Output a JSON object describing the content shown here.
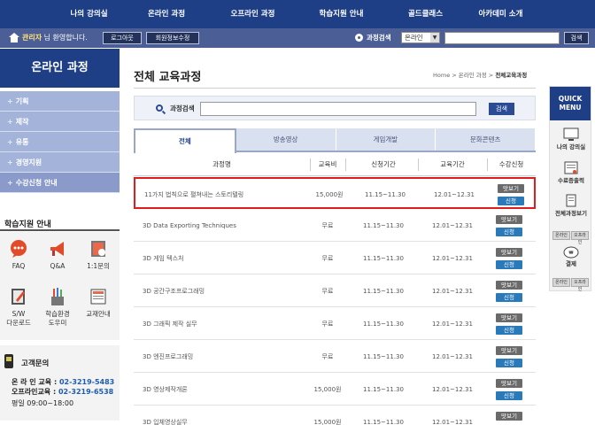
{
  "topnav": [
    "나의 강의실",
    "온라인 과정",
    "오프라인 과정",
    "학습지원 안내",
    "골드클래스",
    "아카데미 소개"
  ],
  "login": {
    "user": "관리자",
    "welcome_suffix": "님 환영합니다.",
    "logout_label": "로그아웃",
    "edit_label": "회원정보수정",
    "search_label": "과정검색",
    "select_value": "온라인",
    "search_button": "검색"
  },
  "sidebar": {
    "title": "온라인 과정",
    "items": [
      "기획",
      "제작",
      "유통",
      "경영지원",
      "수강신청 안내"
    ],
    "support_title": "학습지원 안내",
    "support_items": [
      "FAQ",
      "Q&A",
      "1:1문의",
      "S/W",
      "다운로드",
      "학습환경",
      "도우미",
      "교재안내"
    ],
    "cs_title": "고객문의",
    "cs_online_label": "온 라 인 교육 : ",
    "cs_online_num": "02-3219-5483",
    "cs_offline_label": "오프라인교육 : ",
    "cs_offline_num": "02-3219-6538",
    "cs_hours": "평일 09:00~18:00"
  },
  "main": {
    "title": "전체 교육과정",
    "breadcrumb_prefix": "Home > 온라인 과정 > ",
    "breadcrumb_current": "전체교육과정",
    "search_label": "과정검색",
    "search_button": "검색",
    "tabs": [
      "전체",
      "방송영상",
      "게임개발",
      "문화콘텐츠"
    ],
    "columns": [
      "과정명",
      "교육비",
      "신청기간",
      "교육기간",
      "수강신청"
    ],
    "preview_label": "맛보기",
    "apply_label": "신청",
    "rows": [
      {
        "name": "11가지 법칙으로 펼쳐내는 스토리텔링",
        "fee": "15,000원",
        "apply": "11.15~11.30",
        "study": "12.01~12.31"
      },
      {
        "name": "3D Data Exporting Techniques",
        "fee": "무료",
        "apply": "11.15~11.30",
        "study": "12.01~12.31"
      },
      {
        "name": "3D 게임 텍스처",
        "fee": "무료",
        "apply": "11.15~11.30",
        "study": "12.01~12.31"
      },
      {
        "name": "3D 공간구조프로그래밍",
        "fee": "무료",
        "apply": "11.15~11.30",
        "study": "12.01~12.31"
      },
      {
        "name": "3D 그래픽 제작 실무",
        "fee": "무료",
        "apply": "11.15~11.30",
        "study": "12.01~12.31"
      },
      {
        "name": "3D 엔진프로그래밍",
        "fee": "무료",
        "apply": "11.15~11.30",
        "study": "12.01~12.31"
      },
      {
        "name": "3D 영상제작개론",
        "fee": "15,000원",
        "apply": "11.15~11.30",
        "study": "12.01~12.31"
      },
      {
        "name": "3D 입체영상실무",
        "fee": "15,000원",
        "apply": "11.15~11.30",
        "study": "12.01~12.31"
      }
    ]
  },
  "quick": {
    "title_line1": "QUICK",
    "title_line2": "MENU",
    "items": [
      "나의 강의실",
      "수료증출력",
      "전체과정보기",
      "결제"
    ],
    "sub_online": "온라인",
    "sub_offline": "오프라인"
  },
  "colors": {
    "nav": "#1e3f86",
    "accent_red": "#e01c1c",
    "apply_blue": "#2a79b8"
  }
}
